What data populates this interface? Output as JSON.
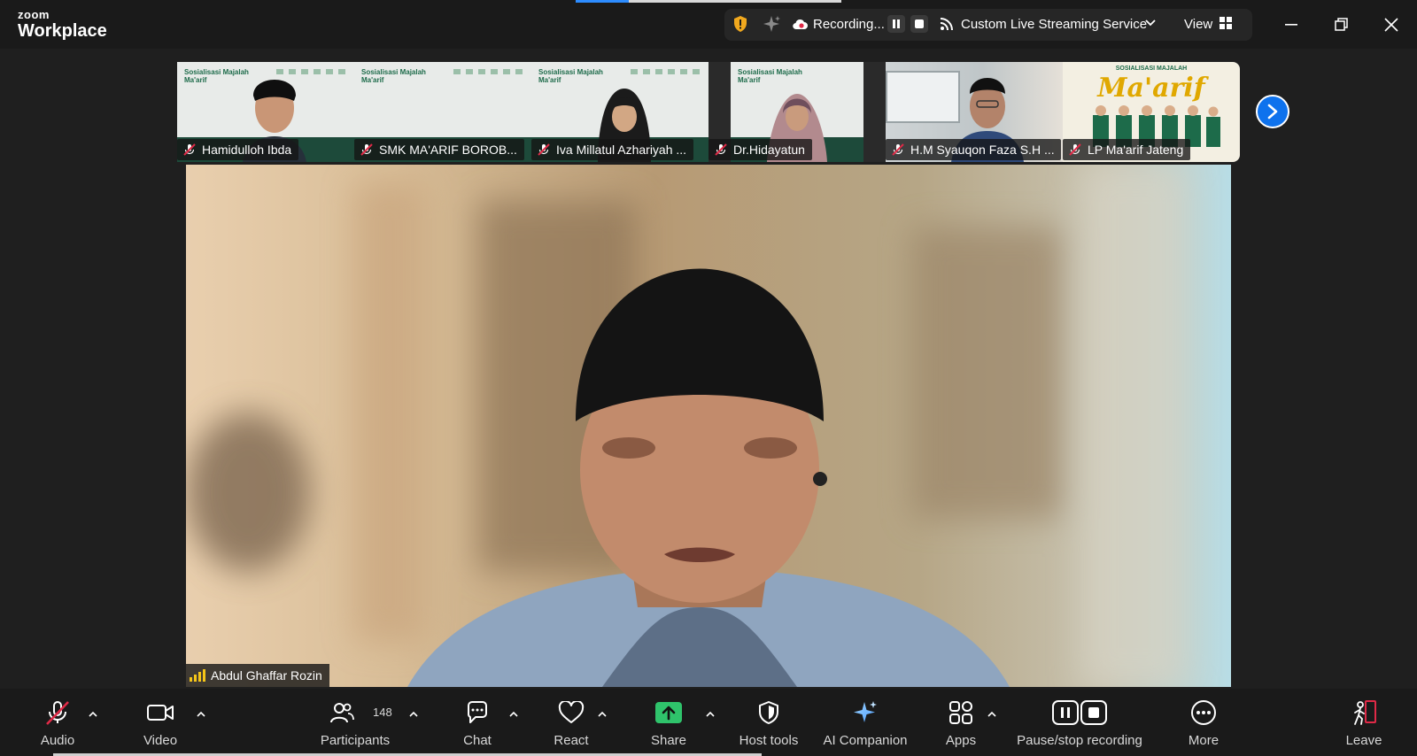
{
  "app": {
    "logo_line1": "zoom",
    "logo_line2": "Workplace"
  },
  "header": {
    "recording_label": "Recording...",
    "streaming_label": "Custom Live Streaming Service",
    "view_label": "View"
  },
  "thumbnails": [
    {
      "name": "Hamidulloh Ibda",
      "slide_title": "Sosialisasi Majalah\nMa'arif"
    },
    {
      "name": "SMK MA'ARIF BOROB...",
      "slide_title": "Sosialisasi Majalah\nMa'arif"
    },
    {
      "name": "Iva Millatul Azhariyah ...",
      "slide_title": "Sosialisasi Majalah\nMa'arif"
    },
    {
      "name": "Dr.Hidayatun",
      "slide_title": "Sosialisasi Majalah\nMa'arif"
    },
    {
      "name": "H.M Syauqon Faza S.H ..."
    },
    {
      "name": "LP Ma'arif Jateng",
      "slide_title": "SOSIALISASI MAJALAH",
      "slide_brand": "Ma'arif"
    }
  ],
  "speaker": {
    "name": "Abdul Ghaffar Rozin"
  },
  "toolbar": {
    "audio": "Audio",
    "video": "Video",
    "participants": "Participants",
    "participants_count": "148",
    "chat": "Chat",
    "react": "React",
    "share": "Share",
    "host_tools": "Host tools",
    "ai_companion": "AI Companion",
    "apps": "Apps",
    "pause_stop": "Pause/stop recording",
    "more": "More",
    "leave": "Leave"
  },
  "colors": {
    "accent_blue": "#0e72ed",
    "share_green": "#2fc36b",
    "mute_red": "#e02a47",
    "signal_yellow": "#f5c518"
  }
}
